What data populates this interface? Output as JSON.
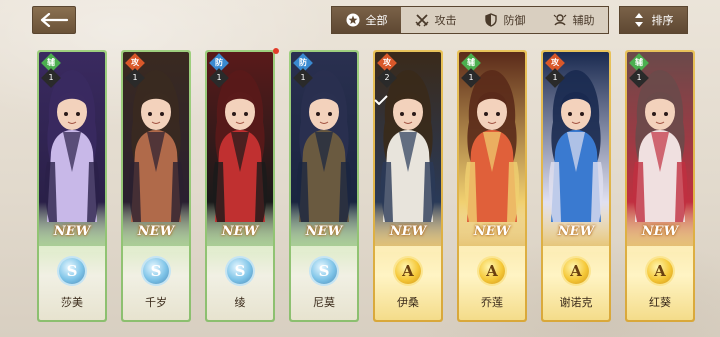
{
  "toolbar": {
    "back_icon": "back-arrow-icon",
    "filters": [
      {
        "label": "全部",
        "icon": "star-icon",
        "active": true
      },
      {
        "label": "攻击",
        "icon": "crossed-swords-icon",
        "active": false
      },
      {
        "label": "防御",
        "icon": "shield-icon",
        "active": false
      },
      {
        "label": "辅助",
        "icon": "support-icon",
        "active": false
      }
    ],
    "sort_label": "排序",
    "sort_icon": "sort-arrows-icon"
  },
  "colors": {
    "support": "#4caf50",
    "attack": "#d9582a",
    "defense": "#3a8ad0",
    "rank_S_border": "#9ecf7e",
    "rank_A_border": "#e8c25a"
  },
  "cards": [
    {
      "name": "莎美",
      "role": "辅",
      "level": "1",
      "rank": "S",
      "badge": "NEW"
    },
    {
      "name": "千岁",
      "role": "攻",
      "level": "1",
      "rank": "S",
      "badge": "NEW"
    },
    {
      "name": "绫",
      "role": "防",
      "level": "1",
      "rank": "S",
      "badge": "NEW"
    },
    {
      "name": "尼莫",
      "role": "防",
      "level": "1",
      "rank": "S",
      "badge": "NEW"
    },
    {
      "name": "伊桑",
      "role": "攻",
      "level": "2",
      "rank": "A",
      "badge": "NEW"
    },
    {
      "name": "乔莲",
      "role": "辅",
      "level": "1",
      "rank": "A",
      "badge": "NEW"
    },
    {
      "name": "谢诺克",
      "role": "攻",
      "level": "1",
      "rank": "A",
      "badge": "NEW"
    },
    {
      "name": "红葵",
      "role": "辅",
      "level": "1",
      "rank": "A",
      "badge": "NEW"
    }
  ]
}
